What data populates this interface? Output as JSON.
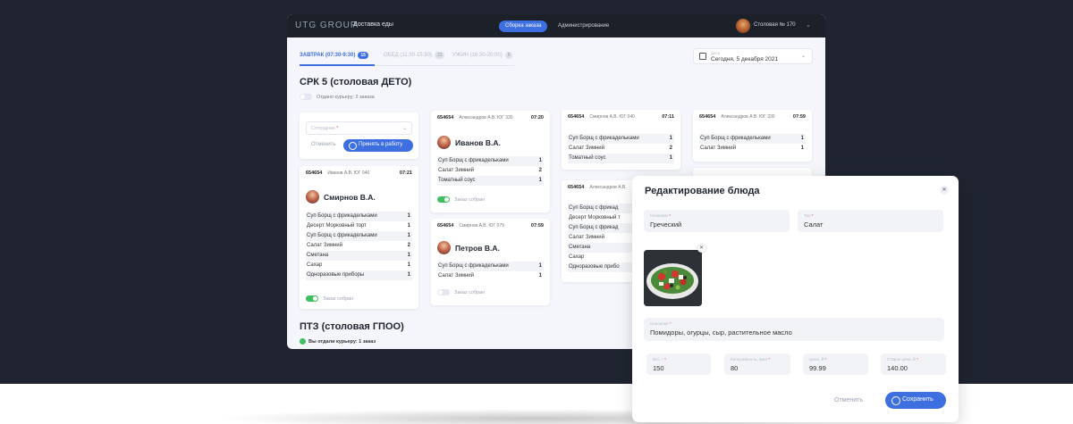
{
  "app": {
    "logo": "UTG GROUP",
    "title": "Доставка еды",
    "nav": [
      "Сборка заказа",
      "Администрирование"
    ],
    "user": "Столовая № 170"
  },
  "tabs": [
    {
      "label": "ЗАВТРАК (07:30-9:30)",
      "count": "15"
    },
    {
      "label": "ОБЕД (11:30-15:30)",
      "count": "13"
    },
    {
      "label": "УЖИН (16:30-20:00)",
      "count": "6"
    }
  ],
  "date": {
    "label": "Дата",
    "value": "Сегодня, 5 декабря 2021"
  },
  "section1": {
    "title": "СРК 5 (столовая ДЕТО)",
    "courier_note": "Отдано курьеру: 2 заказа"
  },
  "action_card": {
    "select_placeholder": "Сотрудник",
    "cancel": "Отменить",
    "accept": "Принять в работу"
  },
  "collected_label": "Заказ собран",
  "cards": {
    "smirnov": {
      "num": "654654",
      "driver": "Иванов А.В. ЮГ 040",
      "time": "07:21",
      "name": "Смирнов В.А.",
      "items": [
        {
          "name": "Суп Борщ с фрикадельками",
          "qty": "1"
        },
        {
          "name": "Десерт Морковный торт",
          "qty": "1"
        },
        {
          "name": "Суп Борщ с фрикадельками",
          "qty": "1"
        },
        {
          "name": "Салат Зимний",
          "qty": "2"
        },
        {
          "name": "Сметана",
          "qty": "1"
        },
        {
          "name": "Сахар",
          "qty": "1"
        },
        {
          "name": "Одноразовые приборы",
          "qty": "1"
        }
      ]
    },
    "ivanov": {
      "num": "654654",
      "driver": "Александров А.В. ЮГ 330",
      "time": "07:20",
      "name": "Иванов В.А.",
      "items": [
        {
          "name": "Суп Борщ с фрикадельками",
          "qty": "1"
        },
        {
          "name": "Салат Зимний",
          "qty": "2"
        },
        {
          "name": "Томатный соус",
          "qty": "1"
        }
      ]
    },
    "petrov": {
      "num": "654654",
      "driver": "Смирнов А.В. ЮГ 079",
      "time": "07:59",
      "name": "Петров В.А.",
      "items": [
        {
          "name": "Суп Борщ с фрикадельками",
          "qty": "1"
        },
        {
          "name": "Салат Зимний",
          "qty": "1"
        }
      ]
    },
    "c4": {
      "num": "654654",
      "driver": "Смирнов А.В. ЮГ 040",
      "time": "07:11",
      "items": [
        {
          "name": "Суп Борщ с фрикадельками",
          "qty": "1"
        },
        {
          "name": "Салат Зимний",
          "qty": "2"
        },
        {
          "name": "Томатный соус",
          "qty": "1"
        }
      ]
    },
    "c5": {
      "num": "654654",
      "driver": "Александров А.В.",
      "items": [
        {
          "name": "Суп Борщ с фрикад"
        },
        {
          "name": "Десерт Морковный т"
        },
        {
          "name": "Суп Борщ с фрикад"
        },
        {
          "name": "Салат Зимний"
        },
        {
          "name": "Сметана"
        },
        {
          "name": "Сахар"
        },
        {
          "name": "Одноразовые прибо"
        }
      ]
    },
    "c6": {
      "num": "654654",
      "driver": "Александров А.В. ЮГ 330",
      "time": "07:59",
      "items": [
        {
          "name": "Суп Борщ с фрикадельками",
          "qty": "1"
        },
        {
          "name": "Салат Зимний",
          "qty": "1"
        }
      ]
    }
  },
  "section2": {
    "title": "ПТЗ (столовая ГПОО)",
    "given_note": "Вы отдали курьеру: 1 заказ"
  },
  "modal": {
    "title": "Редактирование блюда",
    "name_label": "Название",
    "name_value": "Греческий",
    "type_label": "Тип",
    "type_value": "Салат",
    "desc_label": "Описание",
    "desc_value": "Помидоры, огурцы, сыр, растительное масло",
    "weight_label": "Вес, г",
    "weight_value": "150",
    "kcal_label": "Калорийность, ккал",
    "kcal_value": "80",
    "price_label": "Цена, ₽",
    "price_value": "99.99",
    "old_price_label": "Старая цена, ₽",
    "old_price_value": "140.00",
    "cancel": "Отменить",
    "save": "Сохранить"
  },
  "colors": {
    "accent": "#3d6fe0",
    "dark": "#1f2430",
    "success": "#3dbf62"
  }
}
